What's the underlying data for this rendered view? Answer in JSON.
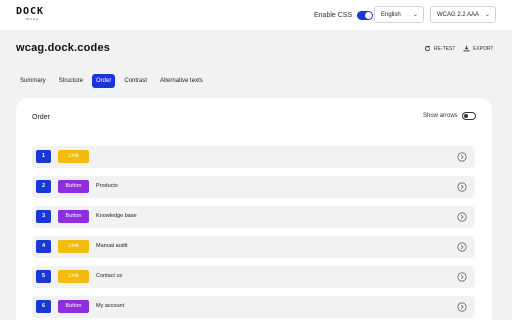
{
  "header": {
    "logo_main": "DOCK",
    "logo_sub": "WCAG",
    "enable_css_label": "Enable CSS",
    "enable_css_on": true,
    "language": "English",
    "level": "WCAG 2.2 AAA"
  },
  "page": {
    "title": "wcag.dock.codes",
    "retest_label": "RE-TEST",
    "export_label": "EXPORT"
  },
  "tabs": [
    {
      "label": "Summary",
      "active": false
    },
    {
      "label": "Structure",
      "active": false
    },
    {
      "label": "Order",
      "active": true
    },
    {
      "label": "Contrast",
      "active": false
    },
    {
      "label": "Alternative texts",
      "active": false
    }
  ],
  "order_panel": {
    "title": "Order",
    "show_arrows_label": "Show arrows",
    "show_arrows_on": false,
    "rows": [
      {
        "index": "1",
        "type": "Link",
        "kind": "link",
        "text": ""
      },
      {
        "index": "2",
        "type": "Button",
        "kind": "button",
        "text": "Products"
      },
      {
        "index": "3",
        "type": "Button",
        "kind": "button",
        "text": "Knowledge base"
      },
      {
        "index": "4",
        "type": "Link",
        "kind": "link",
        "text": "Manual audit"
      },
      {
        "index": "5",
        "type": "Link",
        "kind": "link",
        "text": "Contact us"
      },
      {
        "index": "6",
        "type": "Button",
        "kind": "button",
        "text": "My account"
      }
    ]
  },
  "colors": {
    "accent": "#1936d6",
    "link_badge": "#f2bc0f",
    "button_badge": "#8e2ee0",
    "background": "#f1f2f4"
  }
}
